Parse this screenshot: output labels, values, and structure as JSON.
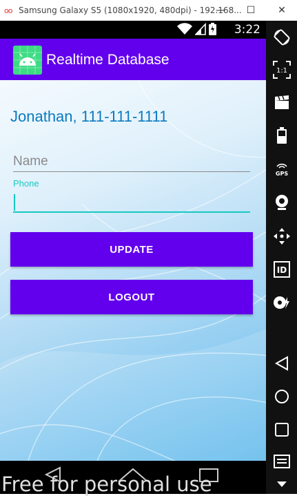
{
  "window": {
    "logo": "oo",
    "title": "Samsung Galaxy S5 (1080x1920, 480dpi) - 192.168...",
    "minimize": "—",
    "maximize": "☐",
    "close": "✕"
  },
  "statusbar": {
    "time": "3:22"
  },
  "appbar": {
    "title": "Realtime Database",
    "icon": "android-icon"
  },
  "main": {
    "greeting": "Jonathan, 111-111-1111",
    "name_placeholder": "Name",
    "name_value": "",
    "phone_label": "Phone",
    "phone_value": "",
    "update_label": "UPDATE",
    "logout_label": "LOGOUT"
  },
  "sidebar": {
    "items": [
      {
        "icon": "rotate-icon"
      },
      {
        "icon": "one-to-one-icon",
        "label": "1:1"
      },
      {
        "icon": "clapperboard-icon"
      },
      {
        "icon": "battery-icon"
      },
      {
        "icon": "gps-icon",
        "label": "GPS"
      },
      {
        "icon": "webcam-icon"
      },
      {
        "icon": "move-icon"
      },
      {
        "icon": "id-icon",
        "label": "ID"
      },
      {
        "icon": "disk-icon"
      },
      {
        "icon": "back-icon"
      },
      {
        "icon": "home-icon"
      },
      {
        "icon": "recents-icon"
      },
      {
        "icon": "menu-icon"
      },
      {
        "icon": "chevron-down-icon"
      }
    ]
  },
  "watermark": "Free for personal use",
  "colors": {
    "primary": "#6200ee",
    "accent": "#16c9c0",
    "greeting": "#0a7abf",
    "app_icon_bg": "#3ddc84"
  }
}
